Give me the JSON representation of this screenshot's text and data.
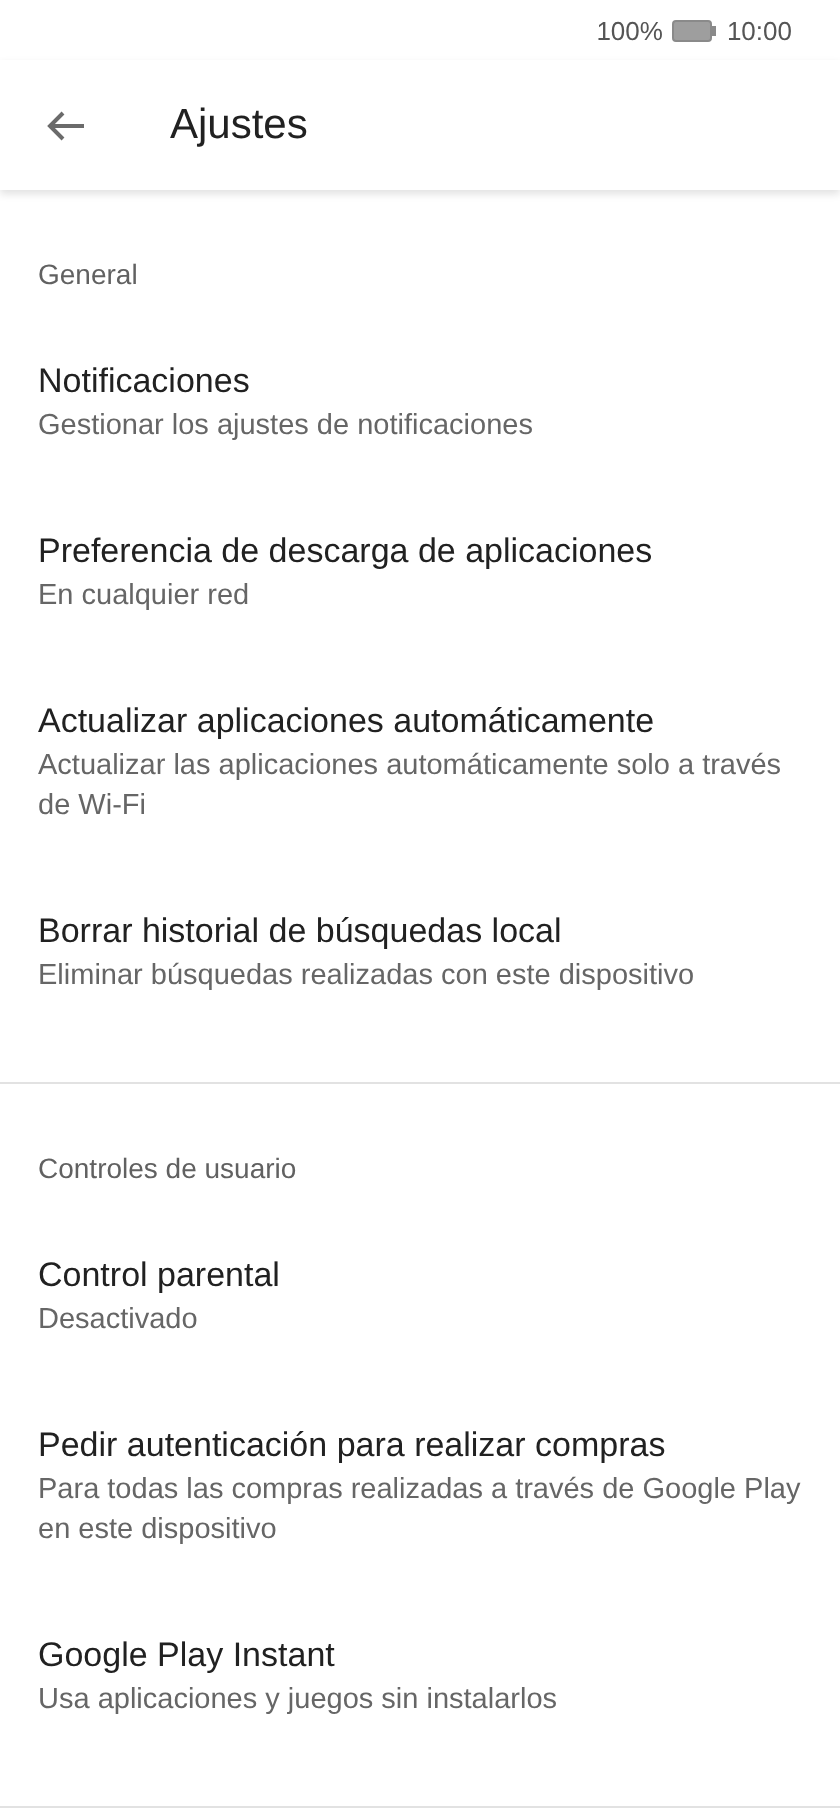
{
  "status_bar": {
    "battery_text": "100%",
    "time": "10:00"
  },
  "header": {
    "title": "Ajustes"
  },
  "sections": [
    {
      "title": "General",
      "items": [
        {
          "title": "Notificaciones",
          "subtitle": "Gestionar los ajustes de notificaciones"
        },
        {
          "title": "Preferencia de descarga de aplicaciones",
          "subtitle": "En cualquier red"
        },
        {
          "title": "Actualizar aplicaciones automáticamente",
          "subtitle": "Actualizar las aplicaciones automáticamente solo a través de Wi-Fi"
        },
        {
          "title": "Borrar historial de búsquedas local",
          "subtitle": "Eliminar búsquedas realizadas con este dispositivo"
        }
      ]
    },
    {
      "title": "Controles de usuario",
      "items": [
        {
          "title": "Control parental",
          "subtitle": "Desactivado"
        },
        {
          "title": "Pedir autenticación para realizar compras",
          "subtitle": "Para todas las compras realizadas a través de Google Play en este dispositivo"
        },
        {
          "title": "Google Play Instant",
          "subtitle": "Usa aplicaciones y juegos sin instalarlos"
        }
      ]
    }
  ]
}
